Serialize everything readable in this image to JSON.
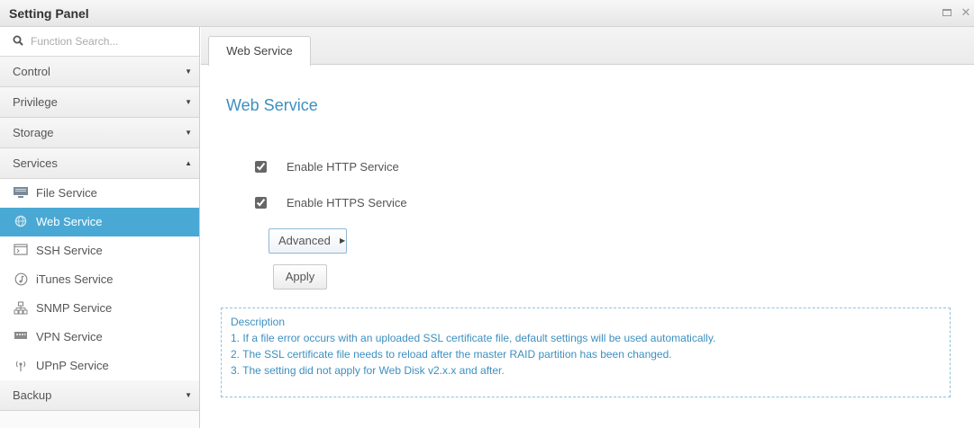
{
  "window": {
    "title": "Setting Panel"
  },
  "search": {
    "placeholder": "Function Search..."
  },
  "sidebar": {
    "categories_top": [
      {
        "label": "Control",
        "arrow": "▼"
      },
      {
        "label": "Privilege",
        "arrow": "▼"
      },
      {
        "label": "Storage",
        "arrow": "▼"
      },
      {
        "label": "Services",
        "arrow": "▲"
      }
    ],
    "services": [
      {
        "label": "File Service",
        "icon": "file-service-icon"
      },
      {
        "label": "Web Service",
        "icon": "web-service-icon",
        "active": true
      },
      {
        "label": "SSH Service",
        "icon": "ssh-terminal-icon"
      },
      {
        "label": "iTunes Service",
        "icon": "music-note-icon"
      },
      {
        "label": "SNMP Service",
        "icon": "network-tree-icon"
      },
      {
        "label": "VPN Service",
        "icon": "vpn-icon"
      },
      {
        "label": "UPnP Service",
        "icon": "upnp-icon"
      }
    ],
    "categories_bottom": [
      {
        "label": "Backup",
        "arrow": "▼"
      }
    ]
  },
  "tabs": [
    {
      "label": "Web Service"
    }
  ],
  "main": {
    "title": "Web Service",
    "http": {
      "label": "Enable HTTP Service",
      "checked": true
    },
    "https": {
      "label": "Enable HTTPS Service",
      "checked": true
    },
    "advanced_label": "Advanced",
    "apply_label": "Apply"
  },
  "description": {
    "heading": "Description",
    "lines": [
      "1. If a file error occurs with an uploaded SSL certificate file, default settings will be used automatically.",
      "2. The SSL certificate file needs to reload after the master RAID partition has been changed.",
      "3. The setting did not apply for Web Disk v2.x.x and after."
    ]
  },
  "colors": {
    "accent": "#4aa9d4",
    "title_blue": "#3d8fbf",
    "desc_border": "#8fc1de"
  }
}
